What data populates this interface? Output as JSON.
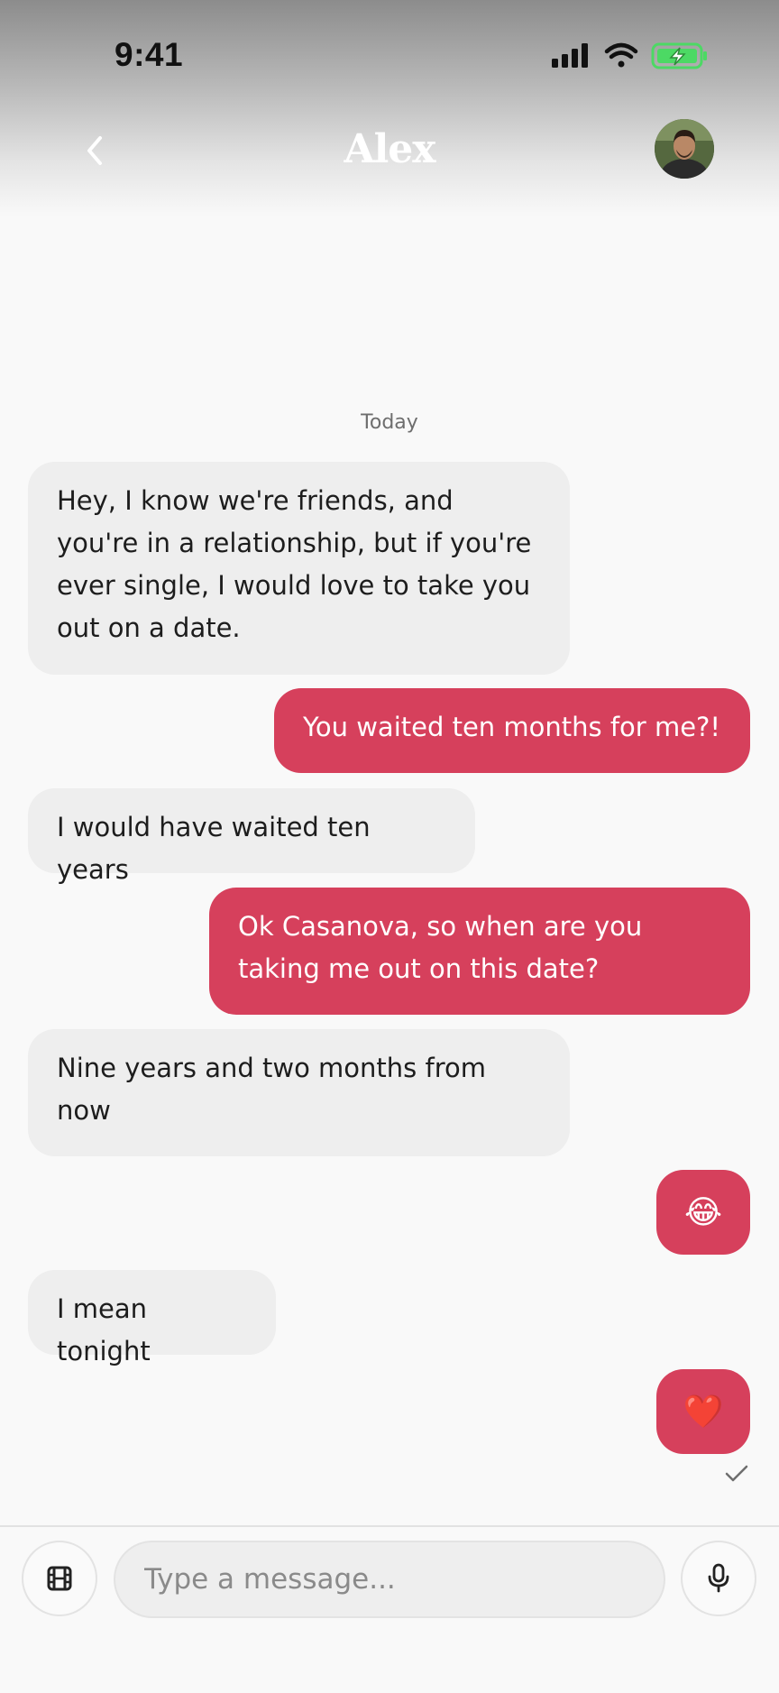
{
  "status_bar": {
    "time": "9:41"
  },
  "header": {
    "title": "Alex",
    "back_icon": "chevron-left-icon",
    "avatar_icon": "avatar"
  },
  "conversation": {
    "date_label": "Today",
    "messages": [
      {
        "direction": "received",
        "text": "Hey, I know we're friends, and you're in a relationship, but if you're ever single, I would love to take you out on a date."
      },
      {
        "direction": "sent",
        "text": "You waited ten months for me?!"
      },
      {
        "direction": "received",
        "text": "I would have waited ten years"
      },
      {
        "direction": "sent",
        "text": "Ok Casanova, so when are you taking me out on this date?"
      },
      {
        "direction": "received",
        "text": "Nine years and two months from now"
      },
      {
        "direction": "sent",
        "text": "😂"
      },
      {
        "direction": "received",
        "text": "I mean tonight"
      },
      {
        "direction": "sent",
        "text": "❤️"
      }
    ],
    "read_receipt_icon": "checkmark-icon"
  },
  "composer": {
    "placeholder": "Type a message...",
    "media_icon": "film-icon",
    "mic_icon": "microphone-icon"
  },
  "colors": {
    "sent_bubble": "#d6405c",
    "received_bubble": "#eeeeee",
    "battery_charging": "#4cd964"
  }
}
